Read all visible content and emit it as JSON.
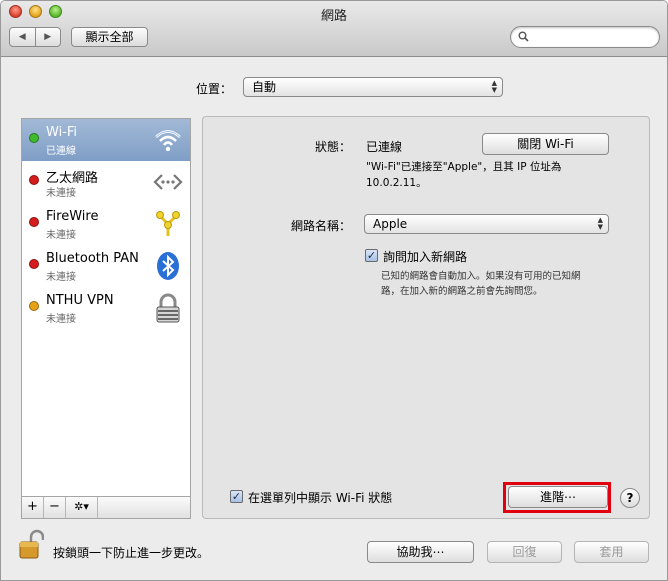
{
  "window": {
    "title": "網路"
  },
  "toolbar": {
    "show_all": "顯示全部",
    "back_glyph": "◀",
    "forward_glyph": "▶",
    "search_placeholder": ""
  },
  "location": {
    "label": "位置：",
    "value": "自動"
  },
  "services": [
    {
      "name": "Wi-Fi",
      "status": "已連線",
      "dot_color": "#3dbb2a",
      "icon": "wifi-icon",
      "selected": true
    },
    {
      "name": "乙太網路",
      "status": "未連接",
      "dot_color": "#d51d1d",
      "icon": "ethernet-icon",
      "selected": false
    },
    {
      "name": "FireWire",
      "status": "未連接",
      "dot_color": "#d51d1d",
      "icon": "firewire-icon",
      "selected": false
    },
    {
      "name": "Bluetooth PAN",
      "status": "未連接",
      "dot_color": "#d51d1d",
      "icon": "bluetooth-icon",
      "selected": false
    },
    {
      "name": "NTHU VPN",
      "status": "未連接",
      "dot_color": "#e5a215",
      "icon": "vpn-lock-icon",
      "selected": false
    }
  ],
  "list_toolbar": {
    "add": "+",
    "remove": "−",
    "gear": "✲▾"
  },
  "detail": {
    "status_label": "狀態：",
    "status_value": "已連線",
    "wifi_toggle": "關閉 Wi-Fi",
    "status_desc_1": "\"Wi-Fi\"已連接至\"Apple\"，且其 IP 位址為",
    "status_desc_2": "10.0.2.11。",
    "network_name_label": "網路名稱：",
    "network_name_value": "Apple",
    "ask_join_label": "詢問加入新網路",
    "ask_join_checked": true,
    "ask_join_desc_1": "已知的網路會自動加入。如果沒有可用的已知網",
    "ask_join_desc_2": "路，在加入新的網路之前會先詢問您。",
    "show_in_menubar_label": "在選單列中顯示 Wi-Fi 狀態",
    "show_in_menubar_checked": true,
    "advanced": "進階⋯",
    "help": "?"
  },
  "footer": {
    "lock_text": "按鎖頭一下防止進一步更改。",
    "assist": "協助我⋯",
    "revert": "回復",
    "apply": "套用"
  },
  "colors": {
    "highlight": "#e00010",
    "selection": "#8fa9cd"
  }
}
